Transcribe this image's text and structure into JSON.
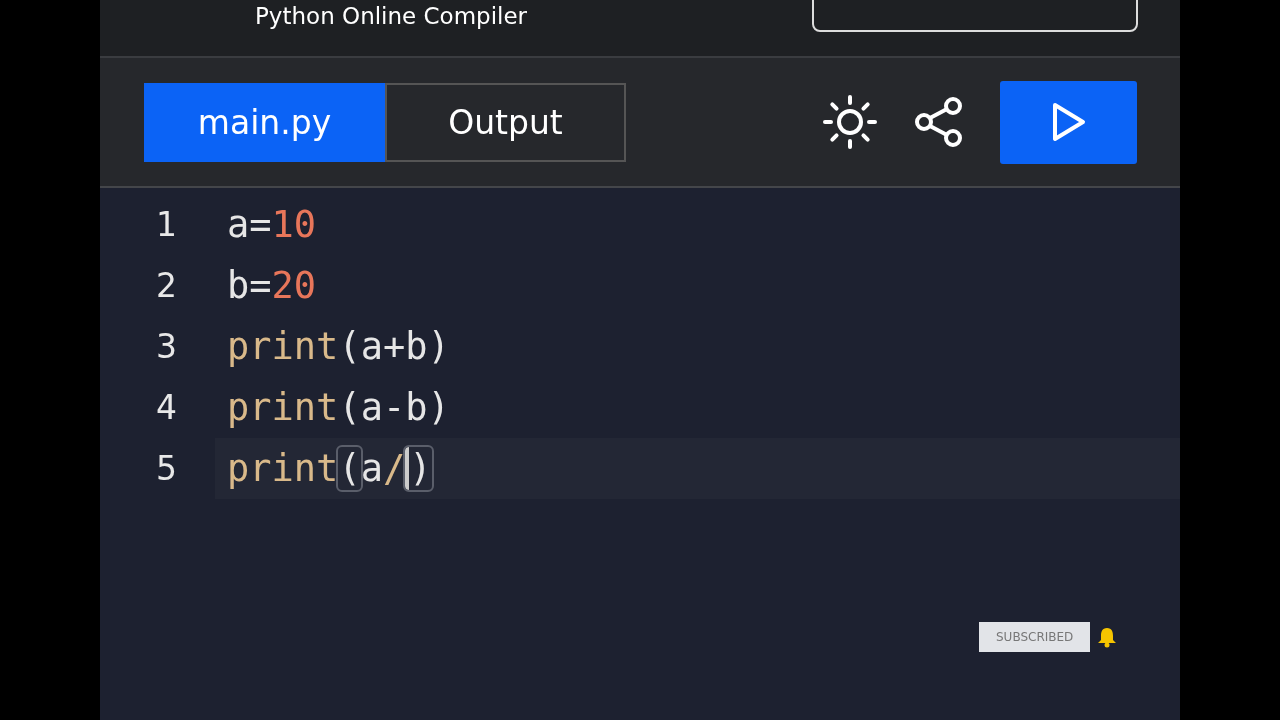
{
  "header": {
    "subtitle": "Python Online Compiler"
  },
  "tabs": [
    {
      "label": "main.py",
      "selected": true
    },
    {
      "label": "Output",
      "selected": false
    }
  ],
  "editor": {
    "lines": [
      {
        "number": "1",
        "current": false,
        "tokens": [
          {
            "text": "a=",
            "kind": "plain"
          },
          {
            "text": "10",
            "kind": "number"
          }
        ]
      },
      {
        "number": "2",
        "current": false,
        "tokens": [
          {
            "text": "b=",
            "kind": "plain"
          },
          {
            "text": "20",
            "kind": "number"
          }
        ]
      },
      {
        "number": "3",
        "current": false,
        "tokens": [
          {
            "text": "print",
            "kind": "func"
          },
          {
            "text": "(a+b)",
            "kind": "plain"
          }
        ]
      },
      {
        "number": "4",
        "current": false,
        "tokens": [
          {
            "text": "print",
            "kind": "func"
          },
          {
            "text": "(a-b)",
            "kind": "plain"
          }
        ]
      },
      {
        "number": "5",
        "current": true,
        "tokens": [
          {
            "text": "print",
            "kind": "func"
          },
          {
            "text": "(",
            "kind": "match"
          },
          {
            "text": "a",
            "kind": "plain"
          },
          {
            "text": "/",
            "kind": "func"
          },
          {
            "text": ")",
            "kind": "match-cursor"
          }
        ]
      }
    ]
  },
  "badge": {
    "label": "SUBSCRIBED"
  }
}
